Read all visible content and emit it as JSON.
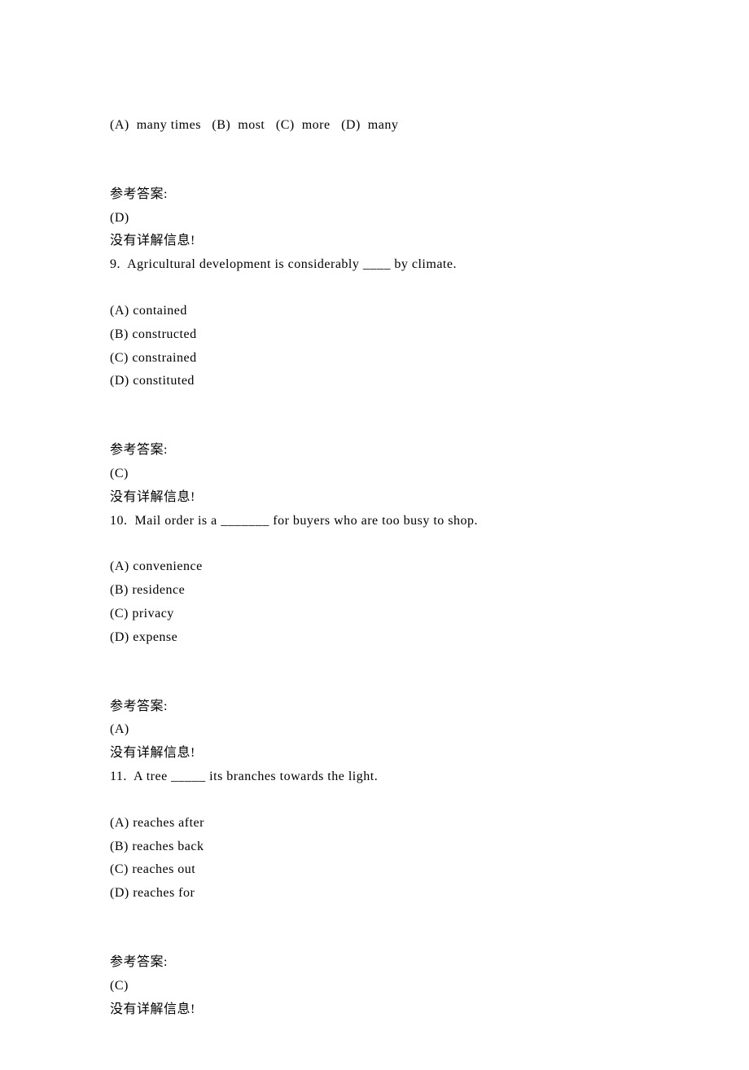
{
  "lines": {
    "l0": "(A)  many times   (B)  most   (C)  more   (D)  many",
    "l1": "参考答案:",
    "l2": "(D)",
    "l3": "没有详解信息!",
    "l4": "9.  Agricultural development is considerably ____ by climate.",
    "l5": "(A) contained",
    "l6": "(B) constructed",
    "l7": "(C) constrained",
    "l8": "(D) constituted",
    "l9": "参考答案:",
    "l10": "(C)",
    "l11": "没有详解信息!",
    "l12": "10.  Mail order is a _______ for buyers who are too busy to shop.",
    "l13": "(A) convenience",
    "l14": "(B) residence",
    "l15": "(C) privacy",
    "l16": "(D) expense",
    "l17": "参考答案:",
    "l18": "(A)",
    "l19": "没有详解信息!",
    "l20": "11.  A tree _____ its branches towards the light.",
    "l21": "(A) reaches after",
    "l22": "(B) reaches back",
    "l23": "(C) reaches out",
    "l24": "(D) reaches for",
    "l25": "参考答案:",
    "l26": "(C)",
    "l27": "没有详解信息!"
  }
}
